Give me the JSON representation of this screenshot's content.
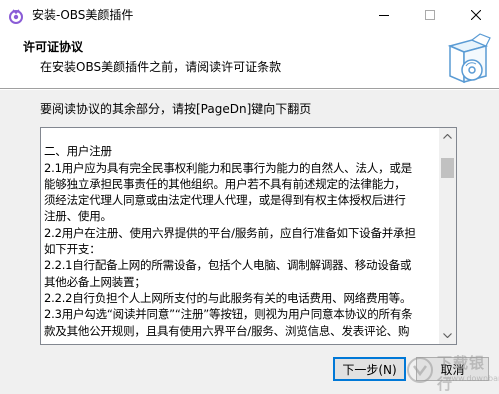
{
  "window": {
    "title": "安装-OBS美颜插件"
  },
  "header": {
    "title": "许可证协议",
    "subtitle": "在安装OBS美颜插件之前，请阅读许可证条款"
  },
  "instruction": "要阅读协议的其余部分，请按[PageDn]键向下翻页",
  "license": {
    "lines": [
      "",
      "二、用户注册",
      "2.1用户应为具有完全民事权利能力和民事行为能力的自然人、法人，或是",
      "能够独立承担民事责任的其他组织。用户若不具有前述规定的法律能力，",
      "须经法定代理人同意或由法定代理人代理，或是得到有权主体授权后进行",
      "注册、使用。",
      "2.2用户在注册、使用六界提供的平台/服务前，应自行准备如下设备并承担",
      "如下开支：",
      "2.2.1自行配备上网的所需设备，包括个人电脑、调制解调器、移动设备或",
      "其他必备上网装置；",
      "2.2.2自行负担个人上网所支付的与此服务有关的电话费用、网络费用等。",
      "2.3用户勾选“阅读并同意”“注册”等按钮，则视为用户同意本协议的所有条",
      "款及其他公开规则，且具有使用六界平台/服务、浏览信息、发表评论、购"
    ]
  },
  "buttons": {
    "next": "下一步(N)",
    "cancel": "取消"
  },
  "watermark": {
    "text": "下载银行",
    "url": "www.downbank.cn"
  },
  "icons": {
    "app": "app-logo-icon",
    "minimize": "minimize-icon",
    "maximize": "maximize-icon",
    "close": "close-icon",
    "header": "software-box-icon",
    "scroll_up": "chevron-up-icon",
    "scroll_down": "chevron-down-icon"
  },
  "colors": {
    "accent": "#0078d7",
    "logo": "#8a5cd6"
  }
}
